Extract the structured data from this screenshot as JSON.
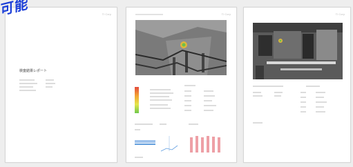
{
  "badge": {
    "text": "可能"
  },
  "pages": [
    {
      "header_right": "TI Corp",
      "title": "検査結果レポート"
    },
    {
      "header_right": "TI Corp"
    },
    {
      "header_right": "TI Corp"
    }
  ],
  "colors": {
    "badge": "#1c3fd8",
    "heat_spot": "#e0b63a",
    "chart_line": "#2f7fd1",
    "pink_bars": "#eea0a6"
  }
}
